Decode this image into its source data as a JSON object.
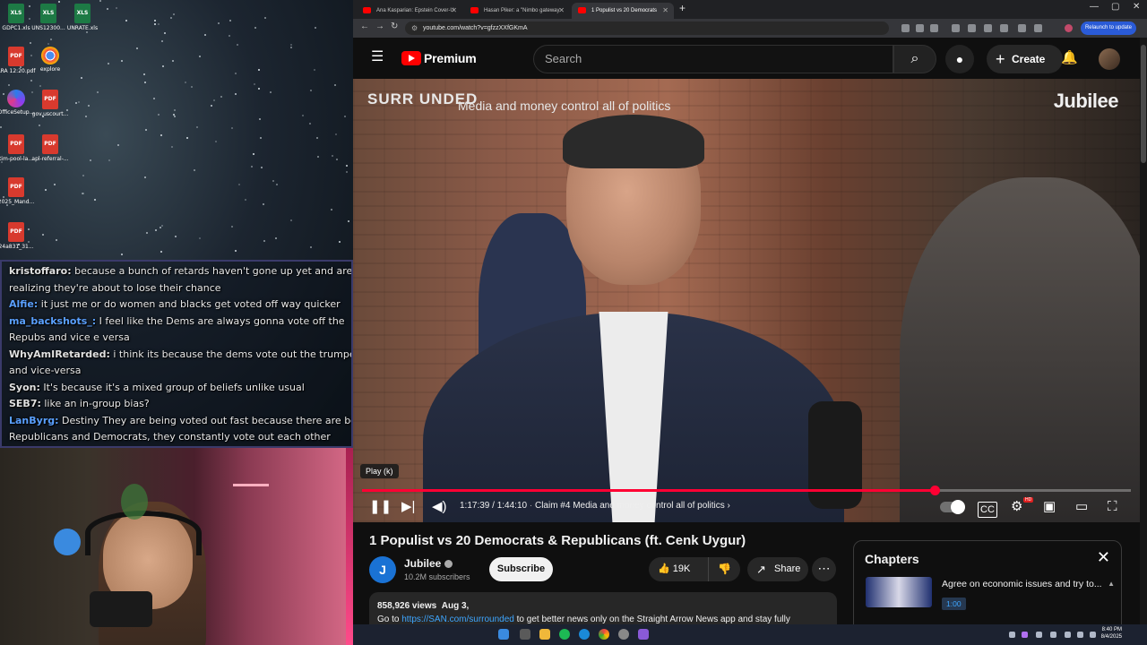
{
  "desktop": {
    "icons": [
      {
        "label": "GDPC1.xls",
        "type": "XLS"
      },
      {
        "label": "UNS12300...",
        "type": "XLS"
      },
      {
        "label": "UNRATE.xls",
        "type": "XLS"
      },
      {
        "label": "ARA 12:20.pdf",
        "type": "PDF"
      },
      {
        "label": "explore",
        "type": "CHROME"
      },
      {
        "label": "OfficeSetup...",
        "type": "OFFICE"
      },
      {
        "label": "gov.uscourt...",
        "type": "PDF"
      },
      {
        "label": "tim-pool-la...",
        "type": "PDF"
      },
      {
        "label": "apl-referral-...",
        "type": "PDF"
      },
      {
        "label": "2025_Mand...",
        "type": "PDF"
      },
      {
        "label": "24a831_31...",
        "type": "PDF"
      }
    ]
  },
  "chat": {
    "messages": [
      {
        "user": "kristoffaro:",
        "user_color": "#e0e0e0",
        "text": " because a bunch of retards haven't gone up yet and are"
      },
      {
        "user": "",
        "user_color": "#e0e0e0",
        "text": "realizing they're about to lose their chance"
      },
      {
        "user": "Alfie:",
        "user_color": "#5aa0ff",
        "text": " it just me or do women and blacks get voted off way quicker"
      },
      {
        "user": "ma_backshots_:",
        "user_color": "#5aa0ff",
        "text": " I feel like the Dems are always gonna vote off the"
      },
      {
        "user": "",
        "user_color": "#e0e0e0",
        "text": "Repubs and vice e versa"
      },
      {
        "user": "WhyAmIRetarded:",
        "user_color": "#e0e0e0",
        "text": " i think its because the dems vote out the trumpers"
      },
      {
        "user": "",
        "user_color": "#e0e0e0",
        "text": "and vice-versa"
      },
      {
        "user": "Syon:",
        "user_color": "#e0e0e0",
        "text": " It's because it's a mixed group of beliefs unlike usual"
      },
      {
        "user": "SEB7:",
        "user_color": "#e0e0e0",
        "text": " like an in-group bias?"
      },
      {
        "user": "LanByrg:",
        "user_color": "#5aa0ff",
        "text": " Destiny They are being voted out fast because there are both"
      },
      {
        "user": "",
        "user_color": "#e0e0e0",
        "text": "Republicans and Democrats, they constantly vote out each other"
      }
    ]
  },
  "browser": {
    "tabs": [
      {
        "title": "Ana Kasparian: Epstein Cover-U",
        "active": false
      },
      {
        "title": "Hasan Piker: a \"Nimbo gateway",
        "active": false
      },
      {
        "title": "1 Populist vs 20 Democrats",
        "active": true
      }
    ],
    "new_tab": "+",
    "url": "youtube.com/watch?v=gfzzXXfGKmA",
    "relaunch_label": "Relaunch to update",
    "window_controls": {
      "minimize": "—",
      "maximize": "▢",
      "close": "✕"
    }
  },
  "youtube": {
    "logo_text": "Premium",
    "search_placeholder": "Search",
    "create_label": "Create",
    "video": {
      "overlay_brand": "SURR UNDED",
      "overlay_tagline": "Media and money control all of politics",
      "overlay_channel": "Jubilee",
      "tooltip": "Play (k)",
      "progress_fraction": 0.7445,
      "time_text": "1:17:39 / 1:44:10",
      "chapter_text": "Claim #4 Media and money control all of politics",
      "hd_badge": "HD"
    },
    "title": "1 Populist vs 20 Democrats & Republicans (ft. Cenk Uygur)",
    "channel": {
      "name": "Jubilee",
      "subscribers": "10.2M subscribers",
      "avatar_letter": "J"
    },
    "subscribe_label": "Subscribe",
    "likes": "19K",
    "share_label": "Share",
    "description": {
      "views": "858,926 views",
      "date": "Aug 3,",
      "prefix": "Go to ",
      "link": "https://SAN.com/surrounded",
      "suffix": " to get better news only on the Straight Arrow News app and stay fully"
    },
    "chapters": {
      "header": "Chapters",
      "items": [
        {
          "title": "Agree on economic issues and try to...",
          "time": "1:00"
        }
      ]
    }
  },
  "taskbar": {
    "clock_time": "8:40 PM",
    "clock_date": "8/4/2025"
  }
}
